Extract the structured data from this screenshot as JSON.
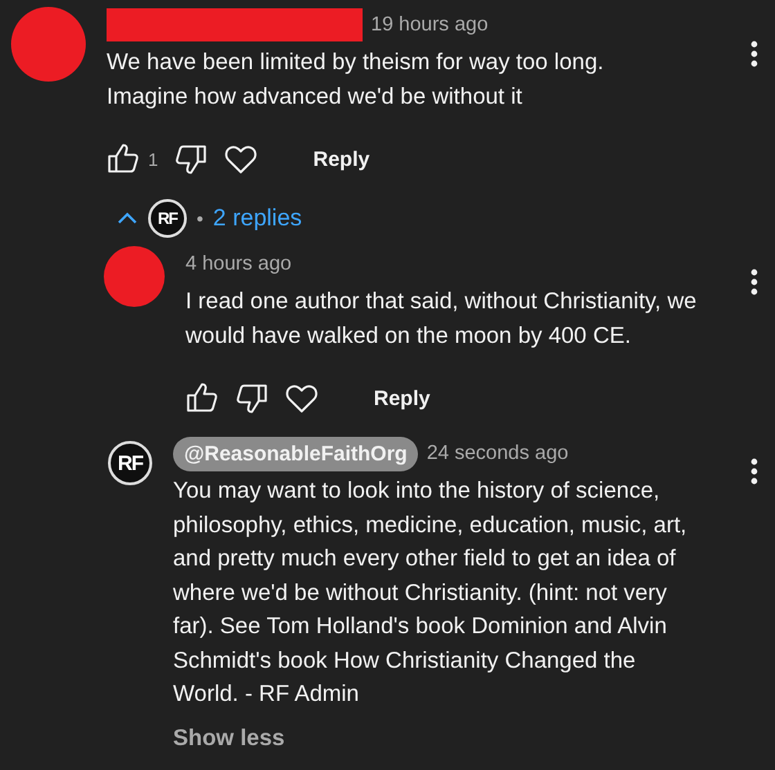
{
  "comments": [
    {
      "avatar": {
        "kind": "redacted"
      },
      "author": {
        "kind": "redacted"
      },
      "time": "19 hours ago",
      "text": "We have been limited by theism for way too long.\nImagine how advanced we'd be without it",
      "actions": {
        "likes": "1",
        "reply": "Reply"
      },
      "replies_toggle": {
        "expanded": true,
        "avatar_text": "RF",
        "separator": "•",
        "label": "2 replies"
      },
      "replies": [
        {
          "avatar": {
            "kind": "redacted"
          },
          "time": "4 hours ago",
          "text": "I read one author that said, without Christianity, we\nwould have walked on the moon by 400 CE.",
          "actions": {
            "reply": "Reply"
          }
        },
        {
          "avatar": {
            "kind": "logo",
            "text": "RF"
          },
          "author": {
            "kind": "chip",
            "name": "@ReasonableFaithOrg"
          },
          "time": "24 seconds ago",
          "text": "You may want to look into the history of science,\nphilosophy, ethics, medicine, education, music, art,\nand pretty much every other field to get an idea of\nwhere we'd be without Christianity. (hint: not very\nfar). See Tom Holland's book Dominion and Alvin\nSchmidt's book How Christianity Changed the\nWorld. - RF Admin",
          "show_less": "Show less"
        }
      ]
    }
  ]
}
